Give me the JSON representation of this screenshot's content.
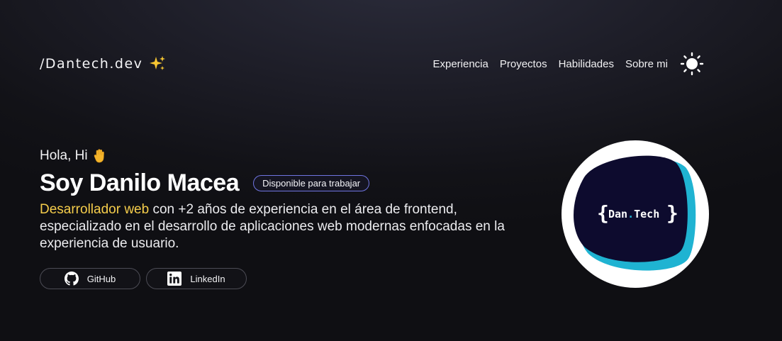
{
  "header": {
    "brand": "/Dantech.dev",
    "sparkle_icon": "sparkles-icon",
    "nav": [
      {
        "label": "Experiencia"
      },
      {
        "label": "Proyectos"
      },
      {
        "label": "Habilidades"
      },
      {
        "label": "Sobre mi"
      }
    ],
    "theme_icon": "sun-icon"
  },
  "hero": {
    "greeting": "Hola, Hi",
    "wave_icon": "raised-hand-icon",
    "name": "Soy Danilo Macea",
    "badge": "Disponible para trabajar",
    "bio_highlight": "Desarrollador web",
    "bio_rest": " con +2 años de experiencia en el área de frontend, especializado en el desarrollo de aplicaciones web modernas enfocadas en la experiencia de usuario.",
    "socials": [
      {
        "label": "GitHub",
        "icon": "github-icon"
      },
      {
        "label": "LinkedIn",
        "icon": "linkedin-icon"
      }
    ]
  },
  "avatar": {
    "logo_text": "Dan.Tech"
  },
  "colors": {
    "highlight": "#f5cd4b",
    "badge_border": "#6f74e0",
    "logo_bg": "#0d0b2e",
    "logo_accent": "#1fb3d2"
  }
}
